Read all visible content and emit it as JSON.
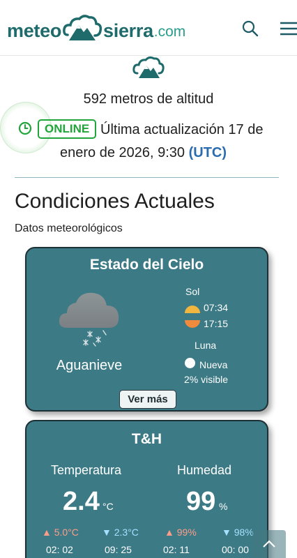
{
  "header": {
    "logo": {
      "part1": "meteo",
      "part2": "sierra",
      "part3": ".com"
    },
    "icons": {
      "search": "search-icon",
      "menu": "hamburger-menu-icon"
    }
  },
  "status": {
    "altitude": "592 metros de altitud",
    "badge": "ONLINE",
    "update_prefix": "Última actualización 17 de enero de 2026, 9:30",
    "timezone": "(UTC)"
  },
  "section": {
    "title": "Condiciones Actuales",
    "subtitle": "Datos meteorológicos"
  },
  "sky_card": {
    "title": "Estado del Cielo",
    "condition": "Aguanieve",
    "sun_label": "Sol",
    "sunrise": "07:34",
    "sunset": "17:15",
    "moon_label": "Luna",
    "moon_phase": "Nueva",
    "moon_visible": "2% visible",
    "button": "Ver más"
  },
  "th_card": {
    "title": "T&H",
    "temp_label": "Temperatura",
    "hum_label": "Humedad",
    "temp_value": "2.4",
    "temp_unit": "°C",
    "hum_value": "99",
    "hum_unit": "%",
    "temp_max": "▲ 5.0°C",
    "temp_min": "▼ 2.3°C",
    "hum_max": "▲ 99%",
    "hum_min": "▼ 98%",
    "temp_max_time": "02: 02",
    "temp_min_time": "09: 25",
    "hum_max_time": "02: 11",
    "hum_min_time": "00: 00"
  },
  "colors": {
    "brand": "#1f6b6b",
    "card_bg": "#3c7a85",
    "online": "#21a53a",
    "utc_link": "#2b6cb0"
  }
}
